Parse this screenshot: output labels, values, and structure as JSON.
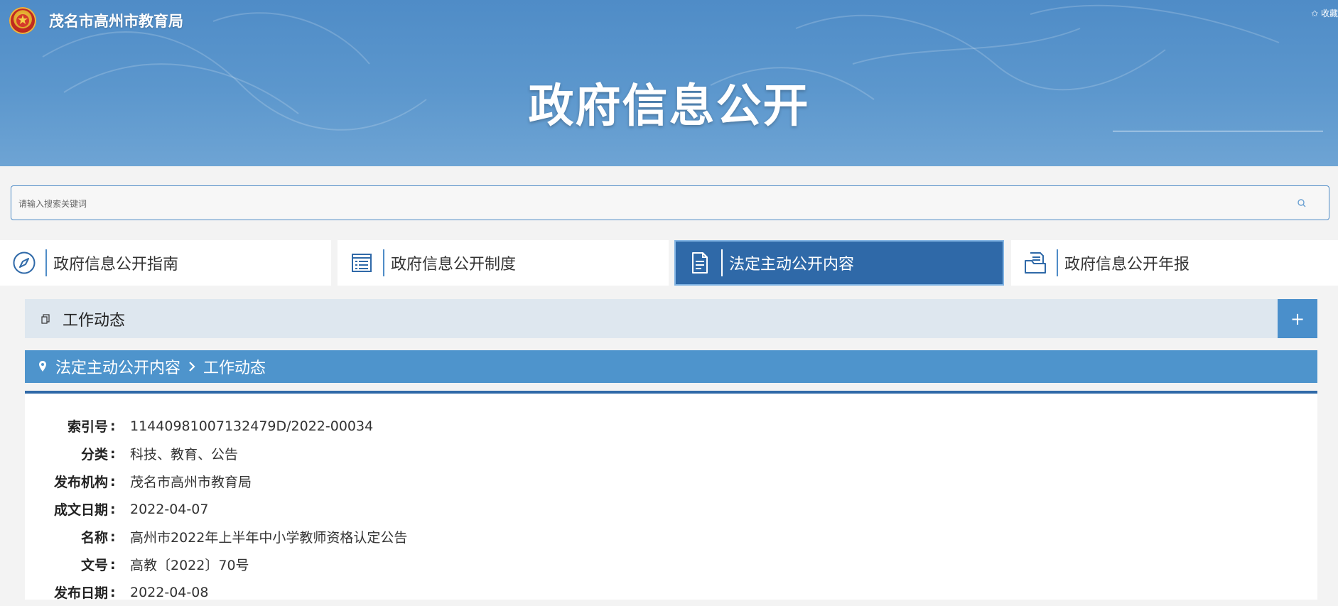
{
  "header": {
    "site_name": "茂名市高州市教育局",
    "favorite_label": "✩ 收藏",
    "banner_title": "政府信息公开"
  },
  "search": {
    "placeholder": "请输入搜索关键词"
  },
  "tabs": [
    {
      "label": "政府信息公开指南",
      "icon": "compass-icon",
      "active": false
    },
    {
      "label": "政府信息公开制度",
      "icon": "list-icon",
      "active": false
    },
    {
      "label": "法定主动公开内容",
      "icon": "document-icon",
      "active": true
    },
    {
      "label": "政府信息公开年报",
      "icon": "folder-icon",
      "active": false
    }
  ],
  "section": {
    "title": "工作动态",
    "expand_label": "+"
  },
  "breadcrumb": {
    "items": [
      "法定主动公开内容",
      "工作动态"
    ]
  },
  "meta": [
    {
      "key": "索引号",
      "value": "11440981007132479D/2022-00034"
    },
    {
      "key": "分类",
      "value": "科技、教育、公告"
    },
    {
      "key": "发布机构",
      "value": "茂名市高州市教育局"
    },
    {
      "key": "成文日期",
      "value": "2022-04-07"
    },
    {
      "key": "名称",
      "value": "高州市2022年上半年中小学教师资格认定公告"
    },
    {
      "key": "文号",
      "value": "高教〔2022〕70号"
    },
    {
      "key": "发布日期",
      "value": "2022-04-08"
    }
  ],
  "colors": {
    "banner": "#5c97cd",
    "active_tab": "#2f69a8",
    "breadcrumb": "#4e94cc",
    "section_bar": "#dee7ef"
  }
}
